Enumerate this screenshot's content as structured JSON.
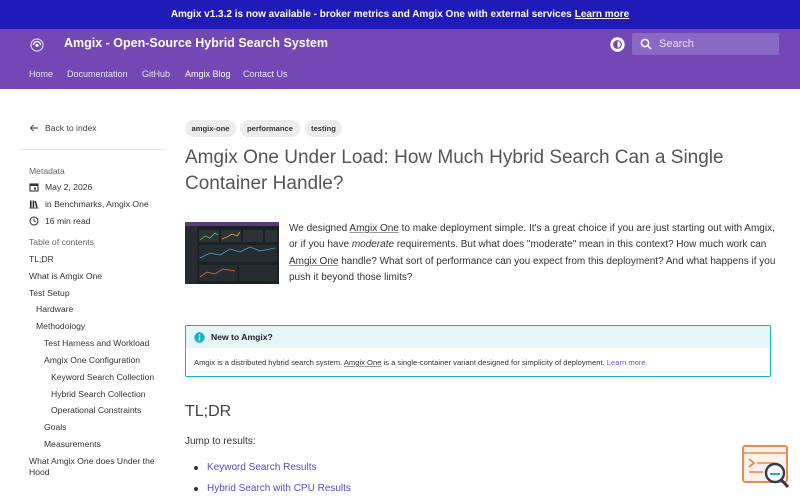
{
  "announcement": {
    "text": "Amgix v1.3.2 is now available - broker metrics and Amgix One with external services",
    "link": "Learn more"
  },
  "header": {
    "title": "Amgix - Open-Source Hybrid Search System",
    "search_placeholder": "Search"
  },
  "nav": {
    "items": [
      "Home",
      "Documentation",
      "GitHub",
      "Amgix Blog",
      "Contact Us"
    ],
    "active": "Amgix Blog"
  },
  "sidebar": {
    "back": "Back to index",
    "metadata_heading": "Metadata",
    "date": "May 2, 2026",
    "categories": "in Benchmarks, Amgix One",
    "read_time": "16 min read",
    "toc_heading": "Table of contents",
    "toc": [
      {
        "label": "TL;DR",
        "level": 0
      },
      {
        "label": "What is Amgix One",
        "level": 0
      },
      {
        "label": "Test Setup",
        "level": 0
      },
      {
        "label": "Hardware",
        "level": 1
      },
      {
        "label": "Methodology",
        "level": 1
      },
      {
        "label": "Test Harness and Workload",
        "level": 2
      },
      {
        "label": "Amgix One Configuration",
        "level": 2
      },
      {
        "label": "Keyword Search Collection",
        "level": 3
      },
      {
        "label": "Hybrid Search Collection",
        "level": 3
      },
      {
        "label": "Operational Constraints",
        "level": 3
      },
      {
        "label": "Goals",
        "level": 2
      },
      {
        "label": "Measurements",
        "level": 2
      },
      {
        "label": "What Amgix One does Under the",
        "level": 0
      },
      {
        "label": "Hood",
        "level": 0
      }
    ]
  },
  "article": {
    "tags": [
      "amgix-one",
      "performance",
      "testing"
    ],
    "title_line1": "Amgix One Under Load: How Much Hybrid Search Can a Single",
    "title_line2": "Container Handle?",
    "intro": {
      "p1": "We designed ",
      "link1": "Amgix One",
      "p2": " to make deployment simple. It's a great choice if you are just starting out with Amgix, or if you have ",
      "em": "moderate",
      "p3": " requirements. But what does \"moderate\" mean in this context? How much work can ",
      "link2": "Amgix One",
      "p4": " handle? What sort of performance can you expect from this deployment? And what happens if you push it beyond those limits?"
    },
    "callout": {
      "title": "New to Amgix?",
      "body1": "Amgix is a distributed hybrid search system. ",
      "body_link": "Amgix One",
      "body2": " is a single-container variant designed for simplicity of deployment. ",
      "learn_more": "Learn more."
    },
    "tldr_heading": "TL;DR",
    "jump": "Jump to results:",
    "results": [
      "Keyword Search Results",
      "Hybrid Search with CPU Results"
    ]
  },
  "colors": {
    "announcement_bg": "#1f1ab8",
    "header_bg": "#7348b4",
    "callout_border": "#16b2c0",
    "link": "#5a4bbf"
  }
}
